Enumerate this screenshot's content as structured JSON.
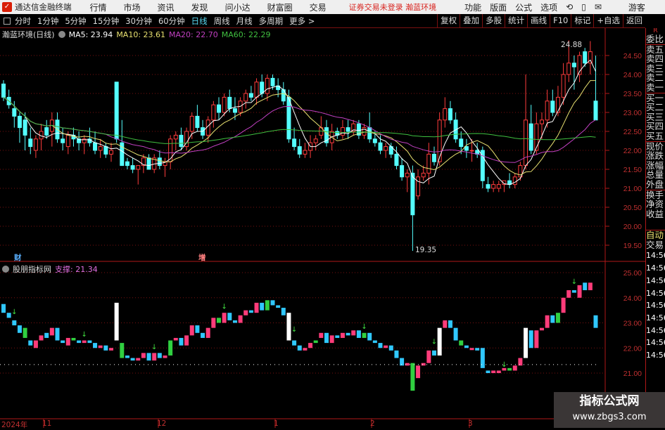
{
  "menubar": {
    "app": "通达信金融终端",
    "items": [
      "行情",
      "市场",
      "资讯",
      "发现",
      "问小达",
      "财富圈",
      "交易"
    ],
    "warning": "证券交易未登录  瀚蓝环境",
    "right": [
      "功能",
      "版面",
      "公式",
      "选项"
    ],
    "user": "游客"
  },
  "toolbar": {
    "periods": [
      "分时",
      "1分钟",
      "5分钟",
      "15分钟",
      "30分钟",
      "60分钟",
      "日线",
      "周线",
      "月线",
      "多周期",
      "更多 >"
    ],
    "active": "日线",
    "right": [
      "复权",
      "叠加",
      "多股",
      "统计",
      "画线",
      "F10",
      "标记",
      "+自选",
      "返回"
    ]
  },
  "main_title": {
    "name": "瀚蓝环境(日线)",
    "ma5": "MA5: 23.94",
    "ma10": "MA10: 23.61",
    "ma20": "MA20: 22.70",
    "ma60": "MA60: 22.29"
  },
  "colors": {
    "up": "#ff3c3c",
    "down": "#54ffff",
    "ma5": "#ffffff",
    "ma10": "#e8e070",
    "ma20": "#c040c0",
    "ma60": "#40c040",
    "grid": "#7a1010"
  },
  "markers": {
    "high": "24.88",
    "low": "19.35",
    "fin": "财",
    "inc": "增"
  },
  "sub_title": {
    "name": "股朋指标网",
    "support": "支撑: 21.34"
  },
  "right_panel": {
    "top": "R",
    "rows": [
      "委比",
      "卖五",
      "卖四",
      "卖三",
      "卖二",
      "卖一",
      "买一",
      "买二",
      "买三",
      "买四",
      "买五",
      "现价",
      "涨跌",
      "涨幅",
      "总量",
      "外盘",
      "换手",
      "净资",
      "收益"
    ],
    "auto": "自动",
    "trade": "交易",
    "times": [
      "14:56",
      "14:56",
      "14:56",
      "14:56",
      "14:56",
      "14:56",
      "14:56",
      "14:56",
      "14:56"
    ]
  },
  "x_axis": {
    "year": "2024年",
    "months": [
      "11",
      "12",
      "1",
      "2",
      "3"
    ]
  },
  "watermark": {
    "line1": "指标公式网",
    "line2": "www.zbgs3.com"
  },
  "chart_data": [
    {
      "type": "candlestick",
      "yticks": [
        "24.50",
        "24.00",
        "23.50",
        "23.00",
        "22.50",
        "22.00",
        "21.50",
        "21.00",
        "20.50",
        "20.00",
        "19.50"
      ],
      "ylim": [
        19.35,
        24.88
      ],
      "ohlc": [
        [
          23.75,
          23.85,
          23.3,
          23.4
        ],
        [
          23.4,
          23.6,
          23.1,
          23.2
        ],
        [
          23.1,
          23.3,
          22.6,
          22.9
        ],
        [
          22.9,
          23.0,
          22.2,
          22.6
        ],
        [
          22.8,
          23.0,
          22.0,
          22.4
        ],
        [
          22.3,
          22.6,
          21.9,
          22.1
        ],
        [
          22.0,
          22.4,
          21.8,
          22.3
        ],
        [
          22.3,
          22.7,
          22.0,
          22.5
        ],
        [
          22.6,
          22.8,
          22.3,
          22.4
        ],
        [
          22.5,
          23.0,
          22.1,
          22.8
        ],
        [
          22.8,
          23.0,
          22.2,
          22.3
        ],
        [
          22.3,
          22.6,
          22.0,
          22.2
        ],
        [
          22.1,
          22.5,
          21.9,
          22.4
        ],
        [
          22.4,
          22.6,
          22.1,
          22.3
        ],
        [
          22.3,
          22.5,
          22.0,
          22.2
        ],
        [
          22.2,
          22.4,
          21.9,
          22.3
        ],
        [
          22.3,
          22.6,
          22.1,
          22.2
        ],
        [
          22.2,
          22.5,
          21.9,
          22.0
        ],
        [
          22.0,
          22.3,
          21.8,
          22.1
        ],
        [
          22.1,
          22.2,
          21.8,
          21.9
        ],
        [
          21.9,
          22.2,
          21.7,
          22.0
        ],
        [
          23.8,
          23.8,
          22.2,
          22.3
        ],
        [
          22.2,
          22.8,
          21.6,
          21.6
        ],
        [
          21.7,
          21.8,
          21.5,
          21.6
        ],
        [
          21.6,
          21.8,
          21.4,
          21.5
        ],
        [
          21.5,
          21.6,
          21.1,
          21.6
        ],
        [
          21.6,
          21.9,
          21.4,
          21.8
        ],
        [
          21.8,
          21.9,
          21.5,
          21.5
        ],
        [
          21.5,
          21.9,
          21.4,
          21.8
        ],
        [
          21.8,
          22.0,
          21.5,
          21.6
        ],
        [
          21.6,
          21.8,
          21.3,
          21.7
        ],
        [
          21.7,
          22.4,
          21.5,
          22.3
        ],
        [
          22.3,
          22.5,
          22.0,
          22.4
        ],
        [
          22.4,
          22.6,
          22.0,
          22.1
        ],
        [
          22.1,
          22.6,
          22.0,
          22.5
        ],
        [
          22.5,
          23.0,
          22.3,
          22.9
        ],
        [
          22.9,
          23.2,
          22.5,
          22.6
        ],
        [
          22.6,
          22.8,
          22.3,
          22.4
        ],
        [
          22.4,
          22.9,
          22.2,
          22.8
        ],
        [
          22.8,
          23.3,
          22.6,
          23.2
        ],
        [
          23.2,
          23.4,
          22.8,
          23.0
        ],
        [
          23.0,
          23.5,
          22.9,
          23.4
        ],
        [
          23.4,
          23.6,
          23.0,
          23.1
        ],
        [
          23.1,
          23.4,
          22.8,
          23.0
        ],
        [
          23.0,
          23.4,
          22.9,
          23.3
        ],
        [
          23.3,
          23.6,
          23.1,
          23.5
        ],
        [
          23.5,
          23.7,
          23.3,
          23.4
        ],
        [
          23.4,
          23.9,
          23.2,
          23.8
        ],
        [
          23.8,
          24.0,
          23.4,
          23.5
        ],
        [
          23.5,
          24.0,
          23.3,
          23.9
        ],
        [
          23.9,
          24.0,
          23.6,
          23.7
        ],
        [
          23.7,
          23.9,
          23.4,
          23.6
        ],
        [
          23.6,
          23.8,
          23.2,
          23.3
        ],
        [
          23.4,
          23.6,
          22.2,
          22.3
        ],
        [
          22.3,
          22.6,
          22.0,
          22.1
        ],
        [
          22.1,
          22.3,
          21.8,
          21.9
        ],
        [
          21.9,
          22.2,
          21.8,
          22.0
        ],
        [
          22.0,
          22.4,
          21.8,
          22.2
        ],
        [
          22.2,
          22.4,
          22.0,
          22.3
        ],
        [
          22.4,
          22.9,
          22.3,
          22.6
        ],
        [
          22.6,
          22.8,
          22.1,
          22.2
        ],
        [
          22.2,
          22.7,
          22.0,
          22.5
        ],
        [
          22.5,
          22.6,
          22.3,
          22.4
        ],
        [
          22.4,
          22.8,
          22.3,
          22.6
        ],
        [
          22.6,
          22.8,
          22.3,
          22.5
        ],
        [
          22.5,
          22.8,
          22.4,
          22.7
        ],
        [
          22.7,
          22.8,
          22.3,
          22.4
        ],
        [
          22.4,
          22.7,
          22.3,
          22.6
        ],
        [
          22.6,
          23.0,
          22.2,
          22.3
        ],
        [
          22.3,
          22.5,
          22.1,
          22.2
        ],
        [
          22.2,
          22.4,
          21.9,
          22.0
        ],
        [
          22.0,
          22.2,
          21.8,
          22.1
        ],
        [
          22.1,
          22.2,
          21.8,
          21.9
        ],
        [
          21.9,
          22.1,
          21.5,
          21.6
        ],
        [
          21.6,
          21.8,
          21.2,
          21.3
        ],
        [
          21.3,
          21.5,
          20.9,
          21.4
        ],
        [
          21.4,
          21.6,
          19.35,
          20.3
        ],
        [
          20.8,
          21.5,
          20.7,
          21.3
        ],
        [
          21.3,
          21.6,
          21.2,
          21.4
        ],
        [
          21.4,
          22.2,
          21.1,
          21.9
        ],
        [
          21.9,
          22.1,
          21.6,
          21.7
        ],
        [
          21.7,
          23.0,
          21.6,
          22.8
        ],
        [
          22.8,
          23.4,
          22.6,
          23.1
        ],
        [
          23.1,
          23.3,
          22.7,
          22.8
        ],
        [
          22.8,
          23.0,
          22.2,
          22.3
        ],
        [
          22.3,
          22.5,
          21.9,
          22.1
        ],
        [
          22.1,
          22.3,
          21.8,
          22.0
        ],
        [
          22.0,
          22.3,
          21.7,
          22.0
        ],
        [
          22.0,
          22.2,
          21.8,
          21.9
        ],
        [
          22.0,
          22.1,
          21.0,
          21.2
        ],
        [
          21.1,
          21.3,
          20.9,
          21.0
        ],
        [
          21.0,
          21.2,
          20.9,
          21.1
        ],
        [
          21.0,
          21.2,
          20.9,
          21.1
        ],
        [
          21.1,
          21.2,
          20.9,
          21.2
        ],
        [
          21.2,
          21.4,
          21.0,
          21.1
        ],
        [
          21.1,
          21.4,
          21.0,
          21.3
        ],
        [
          21.3,
          21.7,
          21.2,
          21.6
        ],
        [
          21.6,
          24.0,
          21.5,
          22.8
        ],
        [
          22.7,
          23.2,
          21.9,
          22.0
        ],
        [
          22.0,
          23.0,
          21.9,
          22.7
        ],
        [
          22.7,
          23.0,
          22.3,
          22.8
        ],
        [
          22.8,
          23.6,
          22.6,
          23.3
        ],
        [
          23.3,
          23.6,
          22.9,
          23.0
        ],
        [
          23.0,
          23.7,
          22.9,
          23.4
        ],
        [
          23.4,
          24.3,
          23.2,
          24.0
        ],
        [
          24.0,
          24.9,
          23.8,
          24.3
        ],
        [
          24.3,
          24.5,
          23.6,
          24.2
        ],
        [
          24.0,
          24.6,
          23.8,
          24.5
        ],
        [
          24.6,
          24.7,
          24.2,
          24.3
        ],
        [
          24.3,
          24.88,
          24.0,
          24.6
        ],
        [
          23.3,
          24.5,
          22.8,
          22.8
        ]
      ]
    },
    {
      "type": "bar",
      "yticks": [
        "25.00",
        "24.00",
        "23.00",
        "22.00",
        "21.00"
      ],
      "support": 21.34
    }
  ]
}
